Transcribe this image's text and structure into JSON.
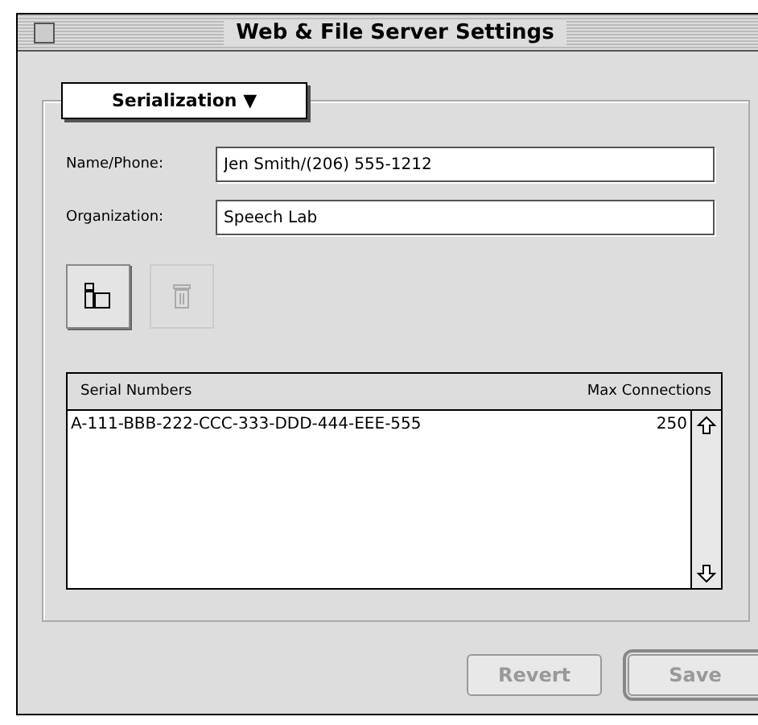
{
  "window": {
    "title": "Web & File Server Settings"
  },
  "popup": {
    "label": "Serialization",
    "caret": "▼"
  },
  "fields": [
    {
      "label": "Name/Phone:",
      "value": "Jen Smith/(206) 555-1212"
    },
    {
      "label": "Organization:",
      "value": "Speech Lab"
    }
  ],
  "tools": [
    {
      "kind": "add",
      "disabled": false
    },
    {
      "kind": "delete",
      "disabled": true
    }
  ],
  "table": {
    "columns": [
      "Serial Numbers",
      "Max Connections"
    ],
    "rows": [
      [
        "A-111-BBB-222-CCC-333-DDD-444-EEE-555",
        "250"
      ]
    ]
  },
  "buttons": [
    {
      "label": "Revert",
      "disabled": true,
      "default": false
    },
    {
      "label": "Save",
      "disabled": true,
      "default": true
    }
  ]
}
